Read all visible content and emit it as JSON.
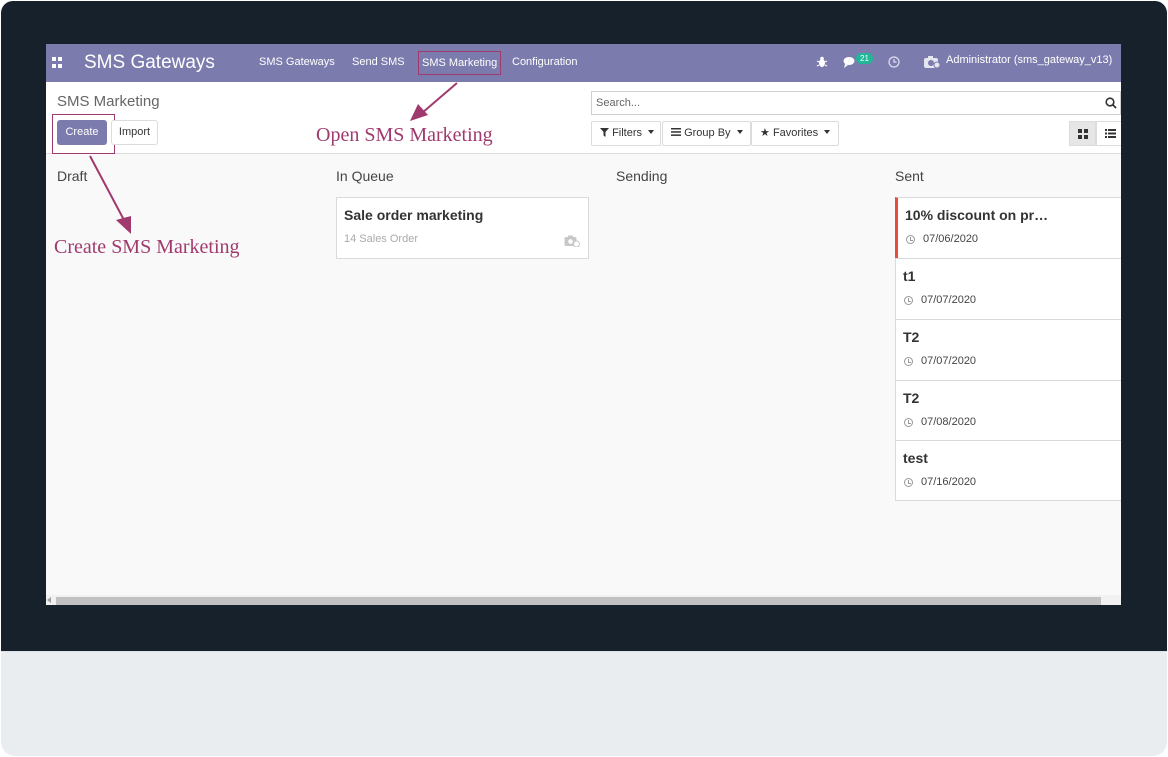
{
  "navbar": {
    "brand": "SMS Gateways",
    "menu": [
      {
        "label": "SMS Gateways"
      },
      {
        "label": "Send SMS"
      },
      {
        "label": "SMS Marketing"
      },
      {
        "label": "Configuration"
      }
    ],
    "messages_count": "21",
    "user": "Administrator (sms_gateway_v13)",
    "icons": [
      "apps-icon",
      "bug-icon",
      "chat-icon",
      "clock-icon",
      "camera-icon"
    ]
  },
  "control": {
    "title": "SMS Marketing",
    "create_label": "Create",
    "import_label": "Import",
    "search_placeholder": "Search...",
    "filters_label": "Filters",
    "groupby_label": "Group By",
    "favorites_label": "Favorites"
  },
  "kanban": {
    "columns": [
      {
        "title": "Draft",
        "cards": []
      },
      {
        "title": "In Queue",
        "cards": [
          {
            "title": "Sale order marketing",
            "sub": "14 Sales Order"
          }
        ]
      },
      {
        "title": "Sending",
        "cards": []
      },
      {
        "title": "Sent",
        "cards": [
          {
            "title": "10% discount on pr…",
            "date": "07/06/2020"
          },
          {
            "title": "t1",
            "date": "07/07/2020"
          },
          {
            "title": "T2",
            "date": "07/07/2020"
          },
          {
            "title": "T2",
            "date": "07/08/2020"
          },
          {
            "title": "test",
            "date": "07/16/2020"
          }
        ]
      }
    ]
  },
  "annotations": {
    "open": "Open SMS Marketing",
    "create": "Create SMS Marketing"
  },
  "colors": {
    "primary": "#7c7bad",
    "annotation": "#a03a6e",
    "accent_border": "#e74c3c",
    "badge": "#21b799"
  }
}
